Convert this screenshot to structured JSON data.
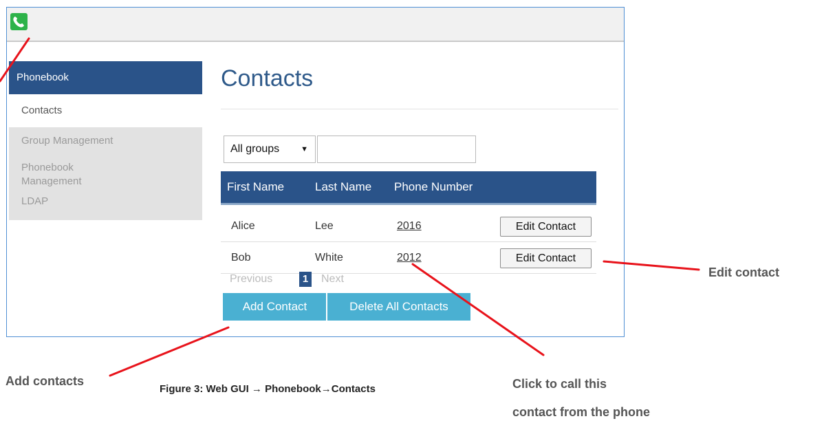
{
  "sidebar": {
    "header": "Phonebook",
    "items": [
      {
        "label": "Contacts"
      },
      {
        "label": "Group Management"
      },
      {
        "label": "Phonebook"
      },
      {
        "label": "Management"
      },
      {
        "label": "LDAP"
      }
    ]
  },
  "main": {
    "title": "Contacts",
    "group_select": "All groups",
    "group_select_arrow": "▼",
    "search_value": ""
  },
  "table": {
    "headers": [
      "First Name",
      "Last Name",
      "Phone Number"
    ],
    "rows": [
      {
        "first": "Alice",
        "last": "Lee",
        "phone": "2016",
        "action": "Edit Contact"
      },
      {
        "first": "Bob",
        "last": "White",
        "phone": "2012",
        "action": "Edit Contact"
      }
    ]
  },
  "pagination": {
    "previous": "Previous",
    "current": "1",
    "next": "Next"
  },
  "buttons": {
    "add": "Add Contact",
    "delete_all": "Delete All Contacts"
  },
  "annotations": {
    "edit": "Edit contact",
    "add": "Add contacts",
    "call_line1": "Click to call this",
    "call_line2": "contact from the phone",
    "caption": "Figure 3: Web GUI → Phonebook→Contacts",
    "line_color": "#e8131b"
  },
  "colors": {
    "header_blue": "#2a5389",
    "button_cyan": "#4ab0d2",
    "title_blue": "#2f5a8a",
    "logo_green": "#2db34a",
    "frame_border": "#4f8fd4"
  },
  "icons": {
    "logo": "phone-handset-icon"
  }
}
